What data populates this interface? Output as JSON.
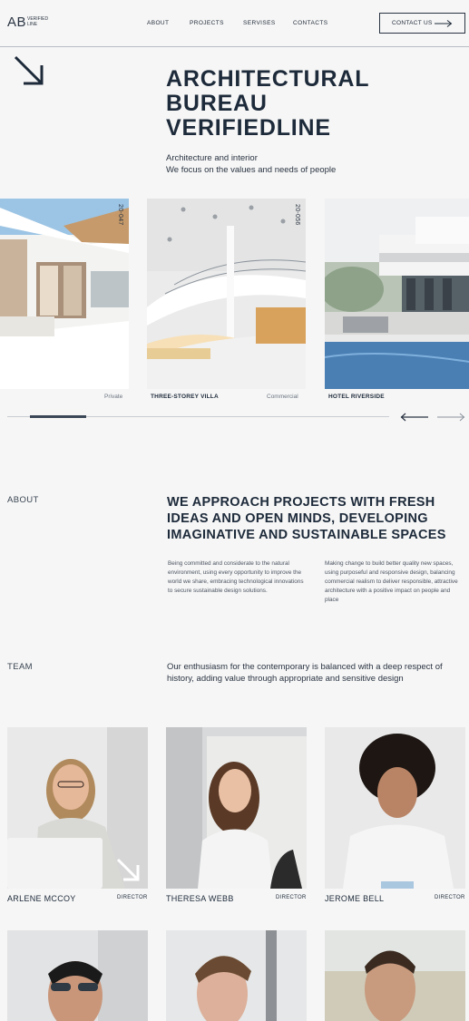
{
  "header": {
    "logo_mark": "AB",
    "logo_text_line1": "VERIFIED",
    "logo_text_line2": "LINE",
    "nav": [
      "ABOUT",
      "PROJECTS",
      "SERVISES",
      "CONTACTS"
    ],
    "cta_label": "CONTACT US"
  },
  "hero": {
    "title_lines": [
      "ARCHITECTURAL",
      "BUREAU",
      "VERIFIEDLINE"
    ],
    "subtitle_lines": [
      "Architecture and interior",
      "We focus on the values and needs of people"
    ]
  },
  "projects": [
    {
      "code": "20-047",
      "category": "Private",
      "name": ""
    },
    {
      "code": "20-056",
      "category": "",
      "name": "THREE-STOREY VILLA"
    },
    {
      "code": "",
      "category": "Commercial",
      "name": "HOTEL RIVERSIDE"
    }
  ],
  "slider": {
    "position": 0.06
  },
  "about": {
    "label": "ABOUT",
    "title_lines": [
      "WE APPROACH PROJECTS WITH FRESH",
      "IDEAS AND OPEN MINDS, DEVELOPING",
      "IMAGINATIVE AND SUSTAINABLE SPACES"
    ],
    "col1": "Being committed and considerate to the natural environment, using every opportunity to improve the world we share, embracing technological innovations to secure sustainable design solutions.",
    "col2": "Making change to build better quality new spaces, using purposeful and responsive design, balancing commercial realism to deliver responsible, attractive architecture with a positive impact on people and place"
  },
  "team": {
    "label": "TEAM",
    "intro": "Our enthusiasm for the contemporary is balanced with a deep respect of history, adding value through appropriate and sensitive design",
    "members": [
      {
        "name": "ARLENE MCCOY",
        "role": "DIRECTOR"
      },
      {
        "name": "THERESA WEBB",
        "role": "DIRECTOR"
      },
      {
        "name": "JEROME BELL",
        "role": "DIRECTOR"
      }
    ]
  },
  "colors": {
    "background": "#f6f6f6",
    "text": "#1c2836",
    "accent": "#3b4757"
  },
  "icons": [
    "arrow-down-right-icon",
    "long-arrow-right-icon",
    "long-arrow-left-icon"
  ]
}
